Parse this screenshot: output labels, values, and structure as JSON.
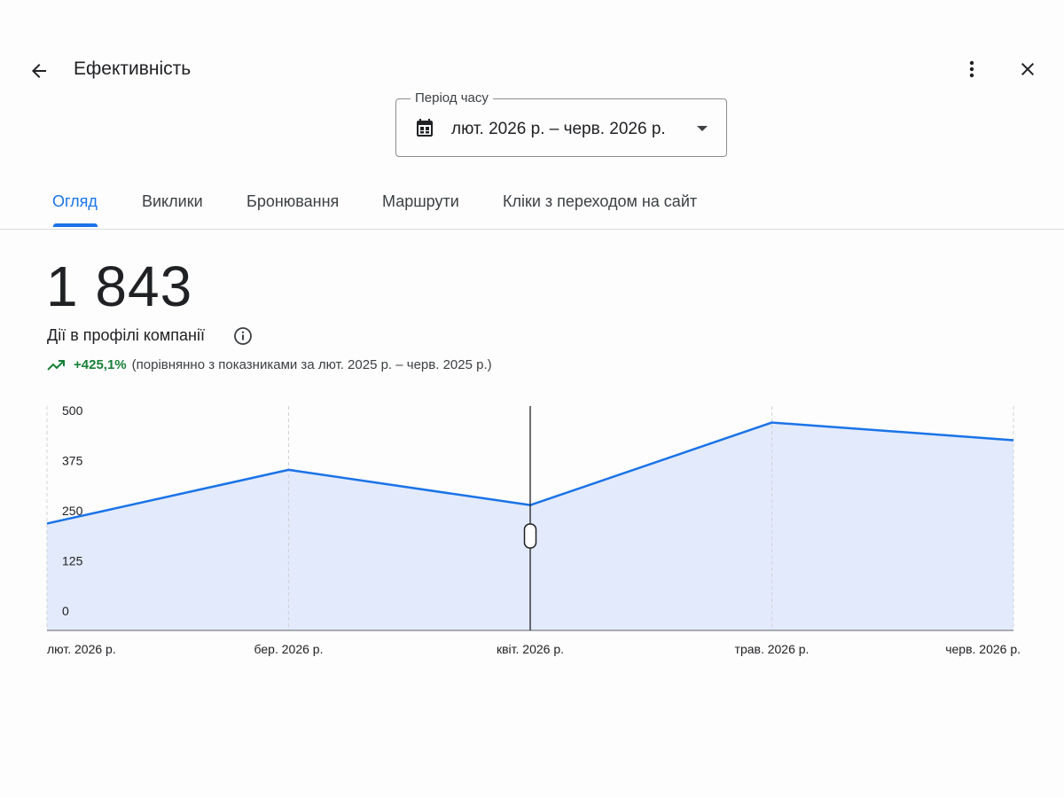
{
  "header": {
    "title": "Ефективність",
    "back_icon": "arrow-back-icon",
    "more_icon": "more-vert-icon",
    "close_icon": "close-icon"
  },
  "period": {
    "label": "Період часу",
    "value": "лют. 2026 р. – черв. 2026 р.",
    "icon": "calendar-icon"
  },
  "tabs": [
    {
      "label": "Огляд",
      "active": true
    },
    {
      "label": "Виклики",
      "active": false
    },
    {
      "label": "Бронювання",
      "active": false
    },
    {
      "label": "Маршрути",
      "active": false
    },
    {
      "label": "Кліки з переходом на сайт",
      "active": false
    }
  ],
  "summary": {
    "total": "1 843",
    "label": "Дії в профілі компанії",
    "change": "+425,1%",
    "comparison": "(порівнянно з показниками за лют. 2025 р. – черв. 2025 р.)"
  },
  "colors": {
    "accent": "#1a73e8",
    "positive": "#188038",
    "area_fill": "#e3eafc"
  },
  "chart_data": {
    "type": "area",
    "x": [
      "лют. 2026 р.",
      "бер. 2026 р.",
      "квіт. 2026 р.",
      "трав. 2026 р.",
      "черв. 2026 р."
    ],
    "values": [
      218,
      352,
      264,
      470,
      426
    ],
    "ylim": [
      0,
      500
    ],
    "yticks": [
      500,
      375,
      250,
      125,
      0
    ],
    "grid": "vertical dashed",
    "hover_index": 2
  }
}
